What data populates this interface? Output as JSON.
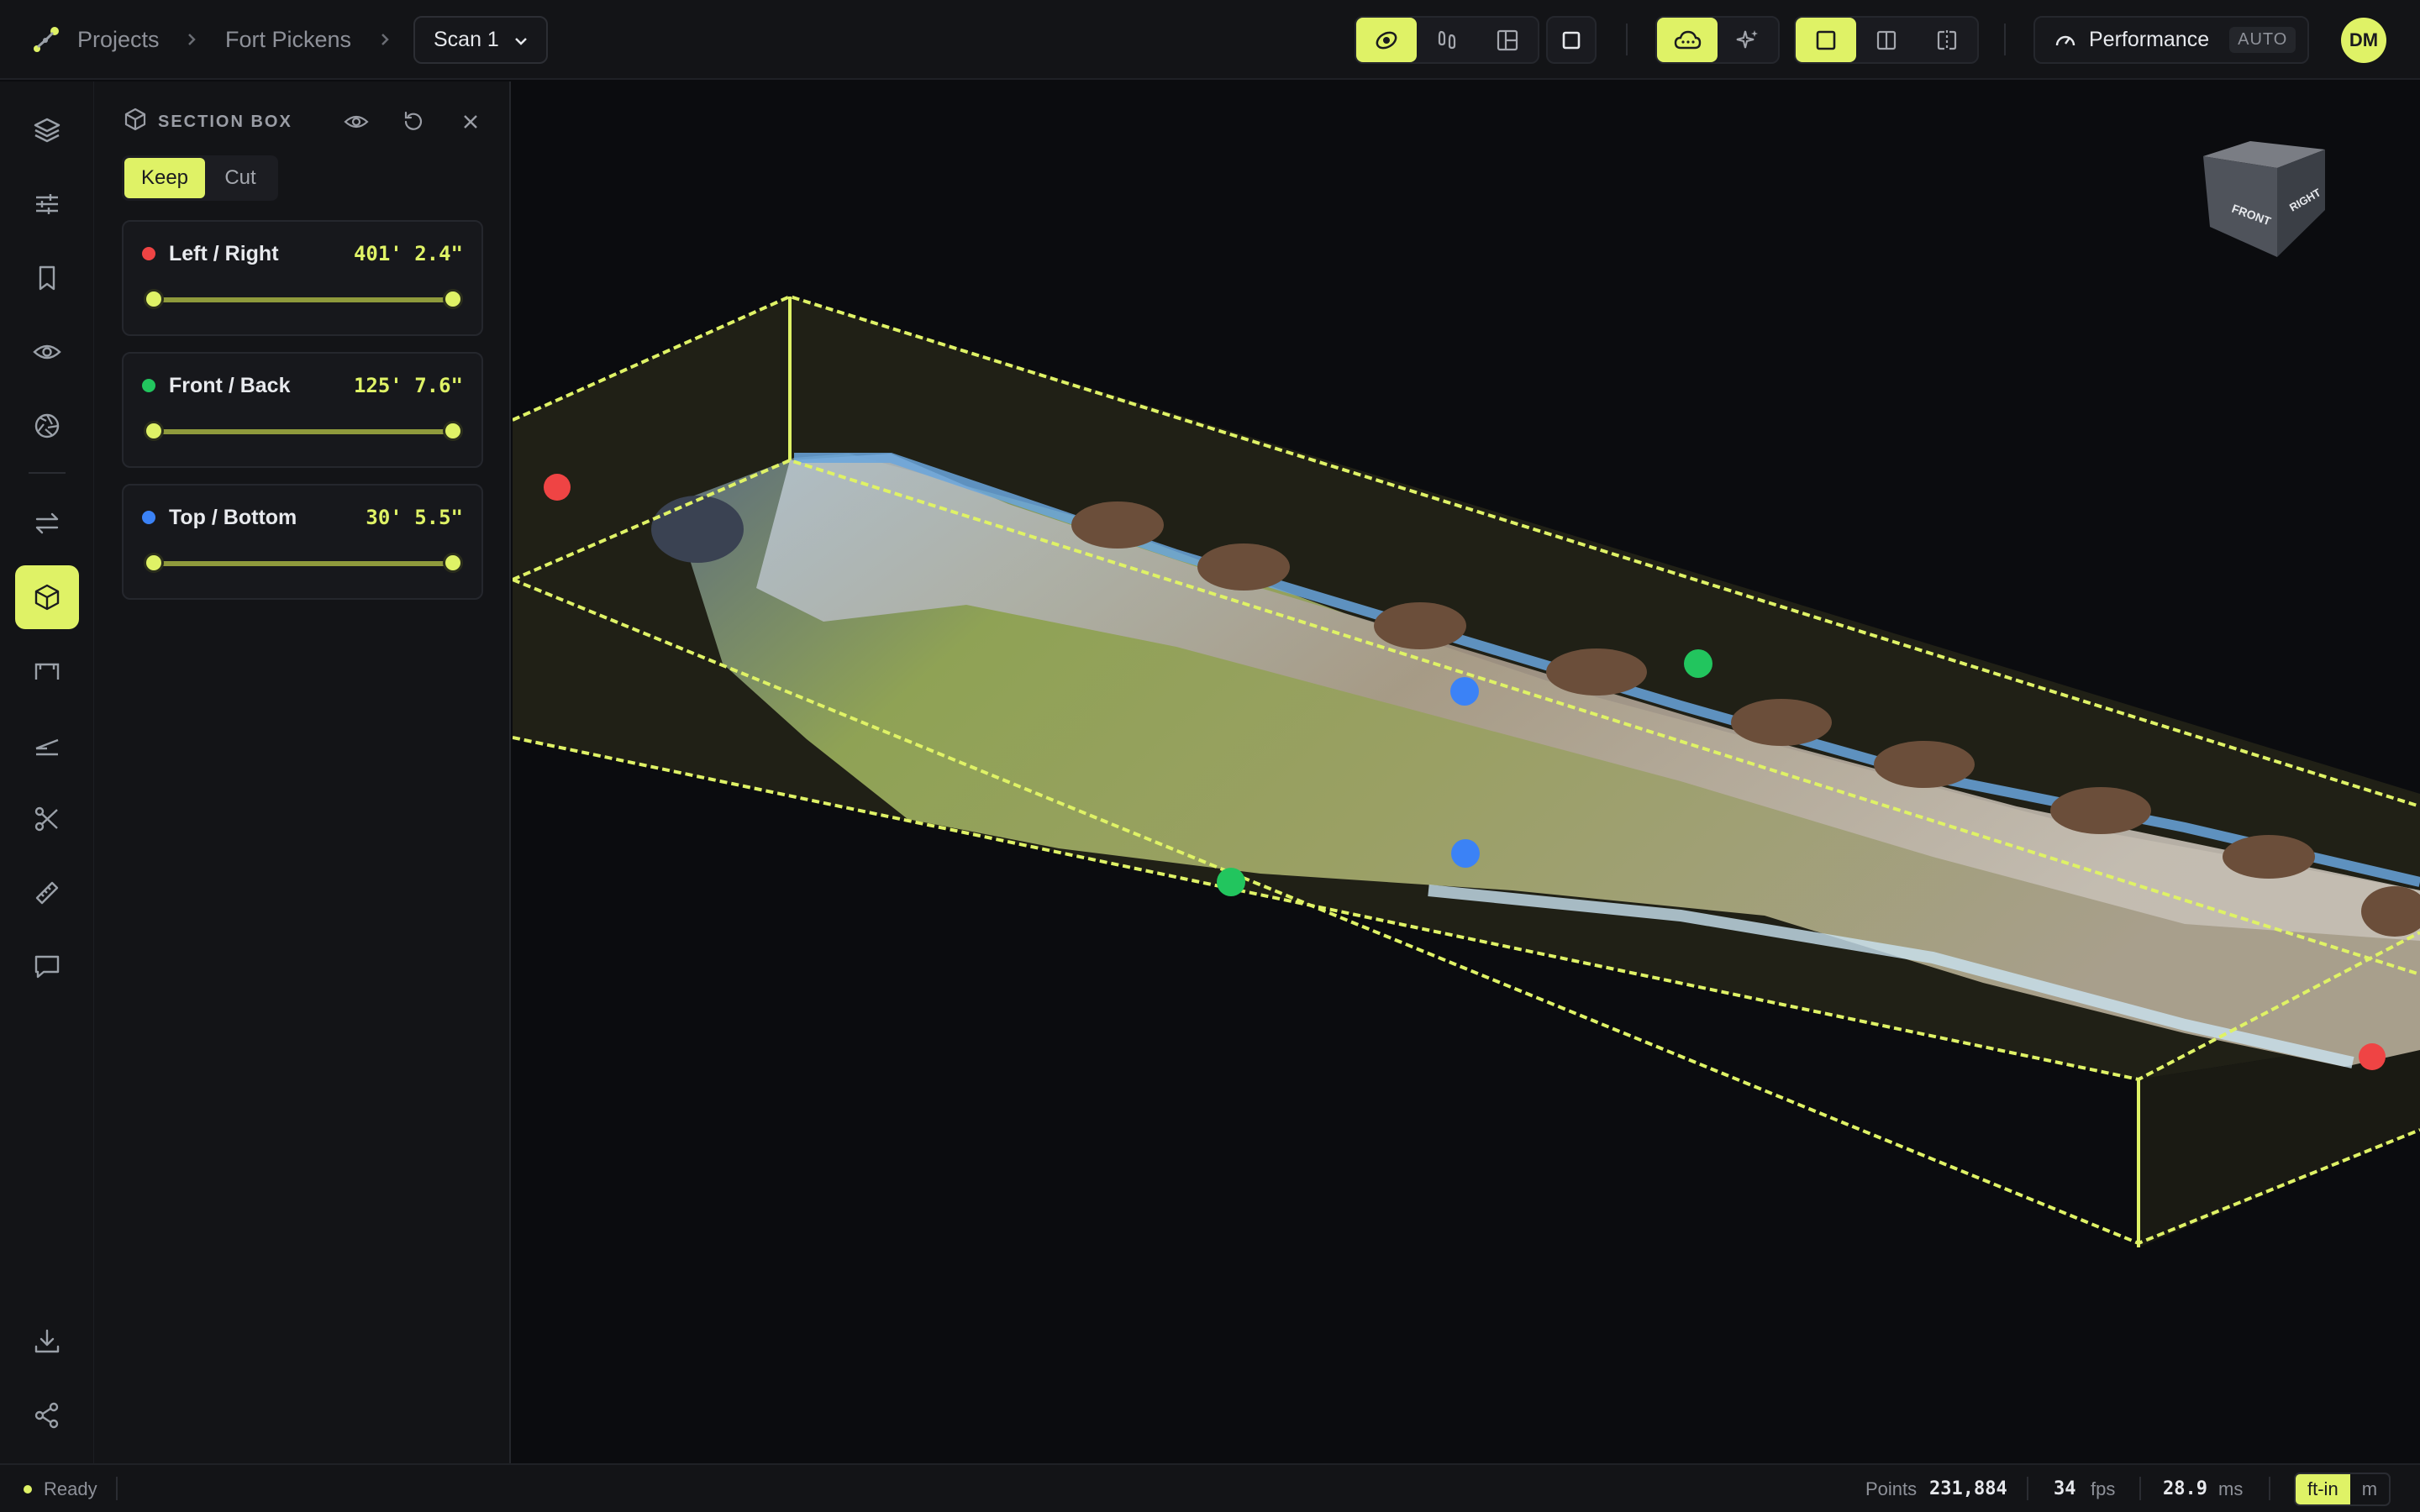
{
  "breadcrumb": {
    "projects": "Projects",
    "project": "Fort Pickens"
  },
  "scan_select": {
    "value": "Scan 1"
  },
  "toolbar": {
    "performance_label": "Performance",
    "performance_mode": "AUTO",
    "user_initials": "DM"
  },
  "section_box": {
    "title": "SECTION BOX",
    "mode_keep": "Keep",
    "mode_cut": "Cut",
    "active_mode": "Keep",
    "axes": [
      {
        "label": "Left / Right",
        "value": "401' 2.4\"",
        "color": "#ef4444",
        "range_min": 0,
        "range_max": 1
      },
      {
        "label": "Front / Back",
        "value": "125' 7.6\"",
        "color": "#22c55e",
        "range_min": 0,
        "range_max": 1
      },
      {
        "label": "Top / Bottom",
        "value": "30' 5.5\"",
        "color": "#3b82f6",
        "range_min": 0,
        "range_max": 1
      }
    ]
  },
  "view_cube": {
    "front": "FRONT",
    "right": "RIGHT"
  },
  "status": {
    "state": "Ready",
    "points_label": "Points",
    "points_value": "231,884",
    "fps_value": "34",
    "fps_label": "fps",
    "ms_value": "28.9",
    "ms_label": "ms",
    "unit_imperial": "ft-in",
    "unit_metric": "m",
    "active_unit": "ft-in"
  },
  "colors": {
    "accent": "#dff266",
    "background": "#0b0c0f",
    "panel": "#131417"
  },
  "icons": {
    "rail": [
      "layers-icon",
      "sliders-icon",
      "bookmark-icon",
      "eye-icon",
      "aperture-icon",
      "swap-icon",
      "cube-icon",
      "floor-plan-icon",
      "elevation-icon",
      "scissors-icon",
      "ruler-icon",
      "comment-icon",
      "download-icon",
      "share-icon"
    ],
    "toolbar": [
      "orbit-icon",
      "walk-icon",
      "layout-icon",
      "square-icon",
      "cloud-icon",
      "sparkle-icon",
      "single-view-icon",
      "split-view-icon",
      "compare-view-icon",
      "gauge-icon"
    ]
  }
}
